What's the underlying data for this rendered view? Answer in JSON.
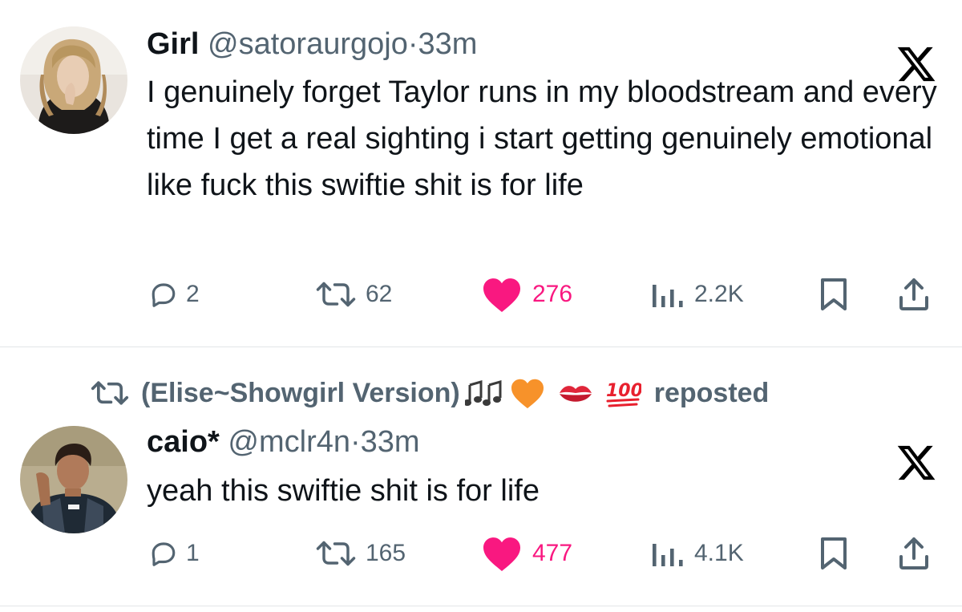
{
  "tweets": [
    {
      "name": "Girl",
      "handle": "@satoraurgojo",
      "dot": "·",
      "time": "33m",
      "text": "I genuinely forget Taylor runs in my bloodstream and every time I get a real sighting i start getting genuinely emotional like fuck this swiftie shit is for life",
      "replies": "2",
      "reposts": "62",
      "likes": "276",
      "views": "2.2K",
      "liked": true
    },
    {
      "repost_context": {
        "reposter": "(Elise~Showgirl Version)",
        "suffix": "reposted",
        "emojis": [
          "musical-notes-icon",
          "orange-heart-icon",
          "kiss-mark-icon",
          "hundred-points-icon"
        ]
      },
      "name": "caio*",
      "handle": "@mclr4n",
      "dot": "·",
      "time": "33m",
      "text": "yeah this swiftie shit is for life",
      "replies": "1",
      "reposts": "165",
      "likes": "477",
      "views": "4.1K",
      "liked": true
    }
  ],
  "colors": {
    "text": "#0f1419",
    "secondary": "#536471",
    "like": "#f91880",
    "divider": "#e2e5e8"
  }
}
